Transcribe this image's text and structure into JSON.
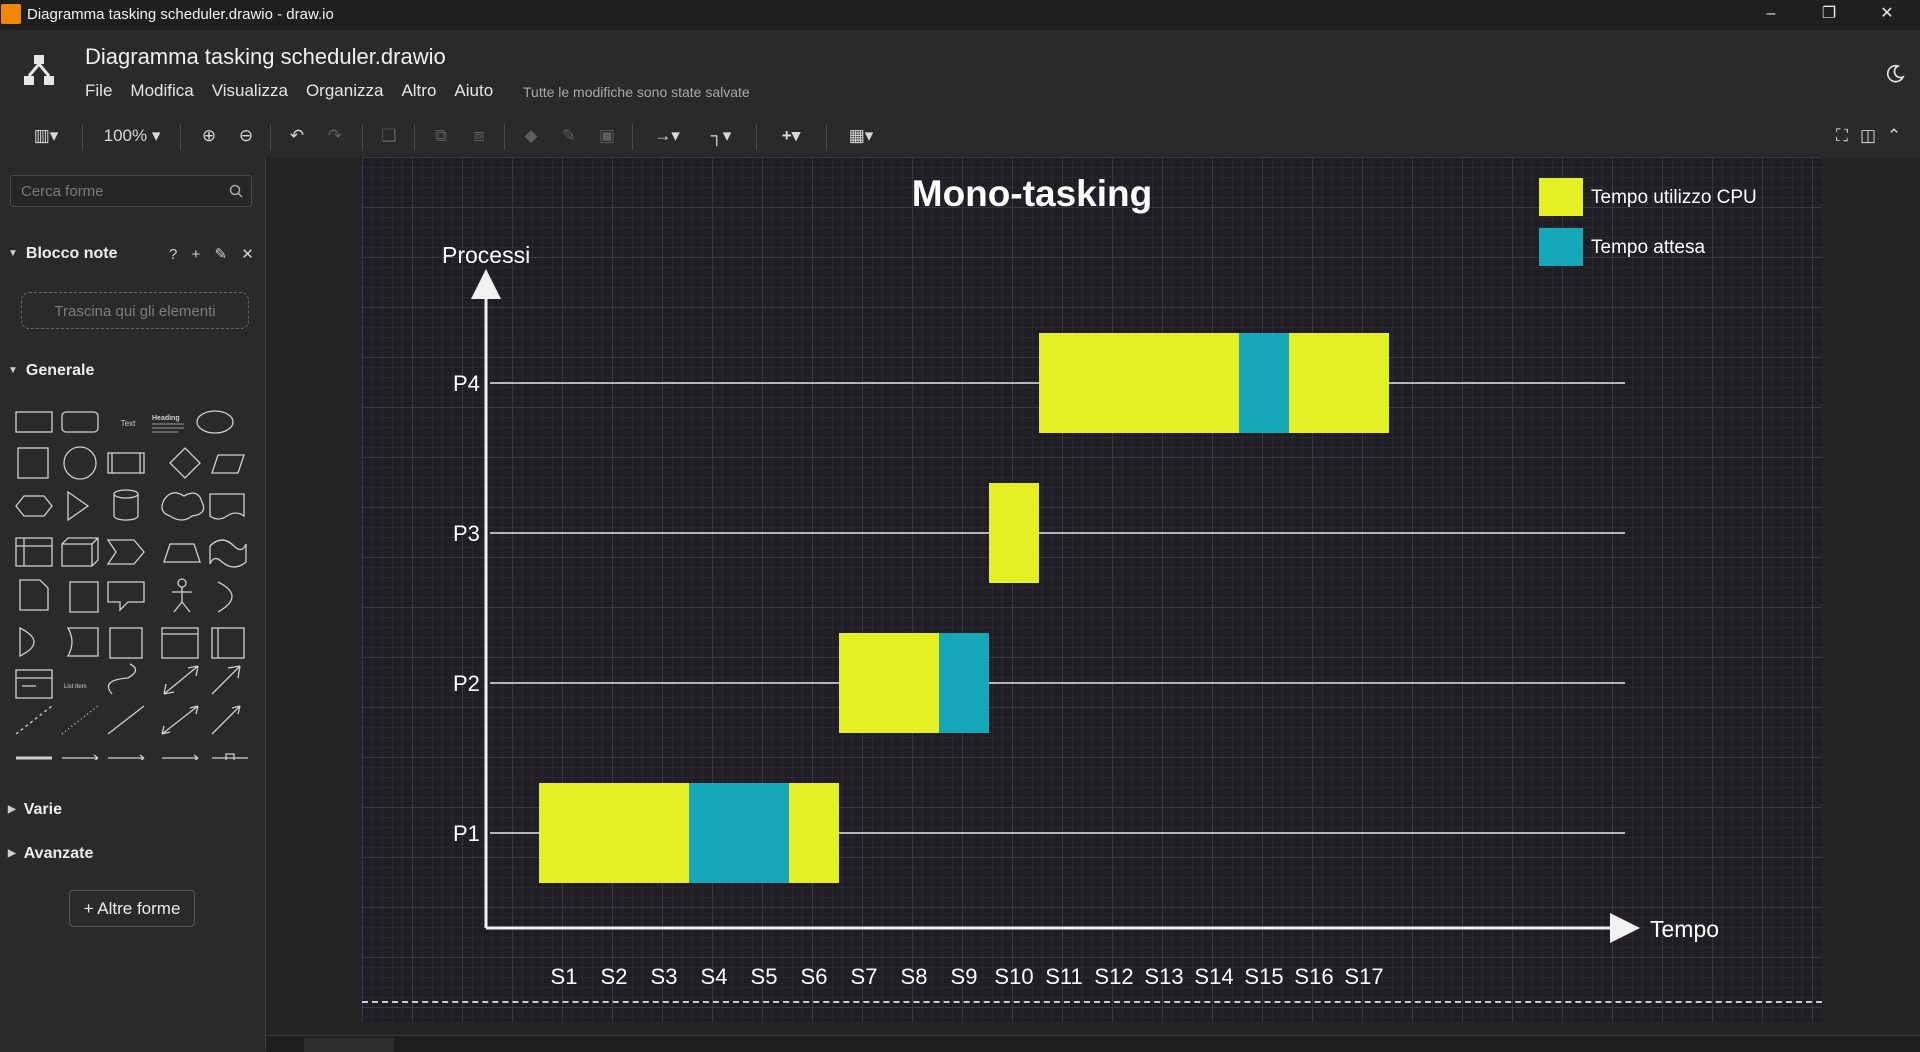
{
  "window": {
    "title": "Diagramma tasking scheduler.drawio - draw.io",
    "controls": [
      "minimize-icon",
      "restore-icon",
      "close-icon"
    ]
  },
  "header": {
    "filename": "Diagramma tasking scheduler.drawio",
    "menu": [
      "File",
      "Modifica",
      "Visualizza",
      "Organizza",
      "Altro",
      "Aiuto"
    ],
    "save_status": "Tutte le modifiche sono state salvate"
  },
  "toolbar": {
    "zoom": "100%",
    "icons": [
      "format-panel-icon",
      "zoom-in-icon",
      "zoom-out-icon",
      "undo-icon",
      "redo-icon",
      "delete-icon",
      "to-front-icon",
      "to-back-icon",
      "fill-color-icon",
      "line-color-icon",
      "shadow-icon",
      "connection-icon",
      "waypoints-icon",
      "insert-icon",
      "table-icon",
      "fullscreen-icon",
      "toggle-format-icon",
      "collapse-icon"
    ]
  },
  "sidebar": {
    "search_placeholder": "Cerca forme",
    "scratchpad": {
      "title": "Blocco note",
      "drop_hint": "Trascina qui gli elementi",
      "tools": [
        "?",
        "+",
        "✎",
        "✕"
      ]
    },
    "general": {
      "title": "Generale"
    },
    "sections": [
      "Varie",
      "Avanzate"
    ],
    "more_shapes": "+ Altre forme",
    "shape_labels": {
      "text": "Text",
      "heading": "Heading",
      "list": "List Item"
    }
  },
  "colors": {
    "cpu": "#e2f024",
    "wait": "#16a7b8",
    "axis": "#f2f2f2",
    "page_bg": "#201d24"
  },
  "chart_data": {
    "type": "gantt",
    "title": "Mono-tasking",
    "ylabel": "Processi",
    "xlabel": "Tempo",
    "categories": [
      "P1",
      "P2",
      "P3",
      "P4"
    ],
    "x_ticks": [
      "S1",
      "S2",
      "S3",
      "S4",
      "S5",
      "S6",
      "S7",
      "S8",
      "S9",
      "S10",
      "S11",
      "S12",
      "S13",
      "S14",
      "S15",
      "S16",
      "S17"
    ],
    "legend": [
      {
        "name": "Tempo utilizzo CPU",
        "color": "#e2f024"
      },
      {
        "name": "Tempo attesa",
        "color": "#16a7b8"
      }
    ],
    "legend_position": "top-right",
    "grid": true,
    "segments": [
      {
        "process": "P1",
        "kind": "cpu",
        "start": 1,
        "end": 3
      },
      {
        "process": "P1",
        "kind": "wait",
        "start": 4,
        "end": 5
      },
      {
        "process": "P1",
        "kind": "cpu",
        "start": 6,
        "end": 6
      },
      {
        "process": "P2",
        "kind": "cpu",
        "start": 7,
        "end": 8
      },
      {
        "process": "P2",
        "kind": "wait",
        "start": 9,
        "end": 9
      },
      {
        "process": "P3",
        "kind": "cpu",
        "start": 10,
        "end": 10
      },
      {
        "process": "P4",
        "kind": "cpu",
        "start": 11,
        "end": 14
      },
      {
        "process": "P4",
        "kind": "wait",
        "start": 15,
        "end": 15
      },
      {
        "process": "P4",
        "kind": "cpu",
        "start": 16,
        "end": 17
      }
    ]
  }
}
